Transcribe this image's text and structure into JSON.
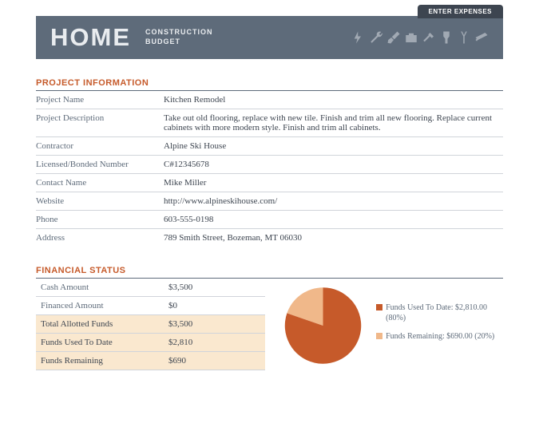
{
  "header": {
    "tab": "ENTER EXPENSES",
    "title_big": "HOME",
    "title_sub1": "CONSTRUCTION",
    "title_sub2": "BUDGET"
  },
  "project_info": {
    "section_title": "PROJECT INFORMATION",
    "rows": [
      {
        "label": "Project Name",
        "value": "Kitchen Remodel"
      },
      {
        "label": "Project Description",
        "value": "Take out old flooring, replace with new tile.  Finish and trim all new flooring.  Replace current cabinets with more modern style.  Finish and trim all cabinets."
      },
      {
        "label": "Contractor",
        "value": "Alpine Ski House"
      },
      {
        "label": "Licensed/Bonded Number",
        "value": "C#12345678"
      },
      {
        "label": "Contact Name",
        "value": "Mike Miller"
      },
      {
        "label": "Website",
        "value": "http://www.alpineskihouse.com/"
      },
      {
        "label": "Phone",
        "value": "603-555-0198"
      },
      {
        "label": "Address",
        "value": "789 Smith Street, Bozeman, MT 06030"
      }
    ]
  },
  "financial": {
    "section_title": "FINANCIAL STATUS",
    "rows": [
      {
        "label": "Cash Amount",
        "value": "$3,500",
        "hl": false
      },
      {
        "label": "Financed Amount",
        "value": "$0",
        "hl": false
      },
      {
        "label": "Total Allotted Funds",
        "value": "$3,500",
        "hl": true
      },
      {
        "label": "Funds Used To Date",
        "value": "$2,810",
        "hl": true
      },
      {
        "label": "Funds Remaining",
        "value": "$690",
        "hl": true
      }
    ]
  },
  "chart_data": {
    "type": "pie",
    "title": "",
    "series": [
      {
        "name": "Funds Used To Date",
        "value": 2810,
        "percent": 80,
        "display": "Funds Used To Date: $2,810.00 (80%)",
        "color": "#c65a2a"
      },
      {
        "name": "Funds Remaining",
        "value": 690,
        "percent": 20,
        "display": "Funds Remaining: $690.00 (20%)",
        "color": "#f0b88a"
      }
    ]
  }
}
